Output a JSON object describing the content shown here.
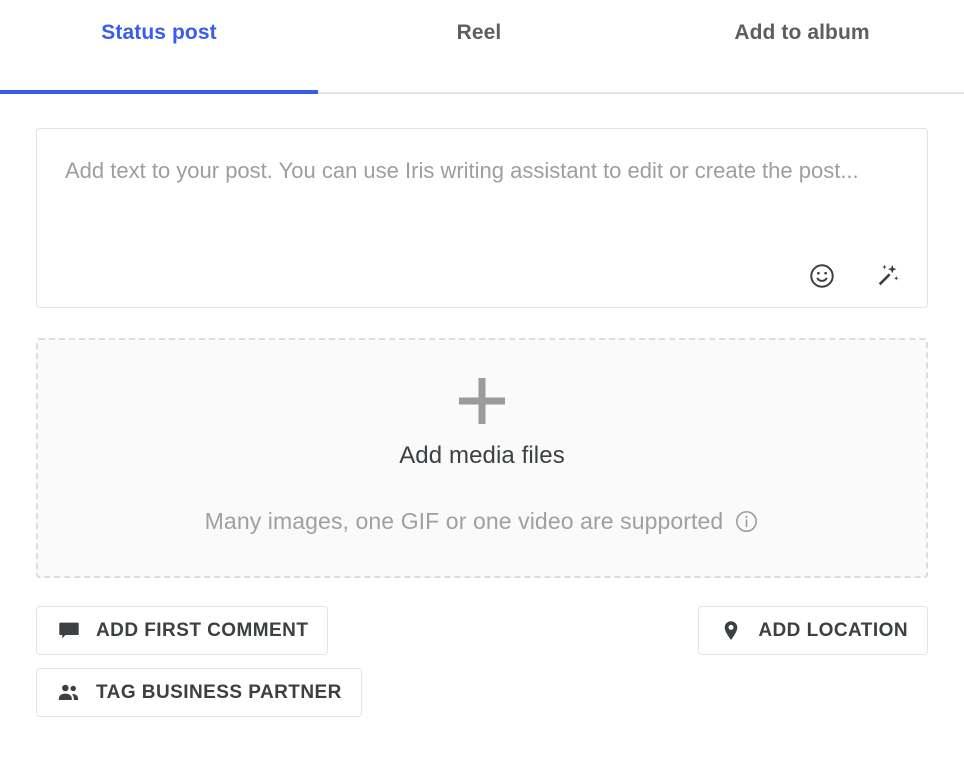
{
  "theme": {
    "accent": "#3a5bf0",
    "text_primary": "#3c4043",
    "text_muted": "#9e9e9e",
    "border": "#e4e4e4",
    "dropzone_bg": "#fafafa"
  },
  "tabs": [
    {
      "label": "Status post",
      "active": true
    },
    {
      "label": "Reel",
      "active": false
    },
    {
      "label": "Add to album",
      "active": false
    }
  ],
  "composer": {
    "placeholder": "Add text to your post. You can use Iris writing assistant to edit or create the post...",
    "value": "",
    "tools": [
      {
        "name": "emoji-icon",
        "title": "Emoji"
      },
      {
        "name": "magic-wand-icon",
        "title": "Iris writing assistant"
      }
    ]
  },
  "dropzone": {
    "plus_icon": "plus-icon",
    "title": "Add media files",
    "hint": "Many images, one GIF or one video are supported",
    "info_icon": "info-icon"
  },
  "actions": {
    "left": [
      {
        "icon": "comment-icon",
        "label": "ADD FIRST COMMENT"
      },
      {
        "icon": "people-icon",
        "label": "TAG BUSINESS PARTNER"
      }
    ],
    "right": [
      {
        "icon": "location-pin-icon",
        "label": "ADD LOCATION"
      }
    ]
  }
}
